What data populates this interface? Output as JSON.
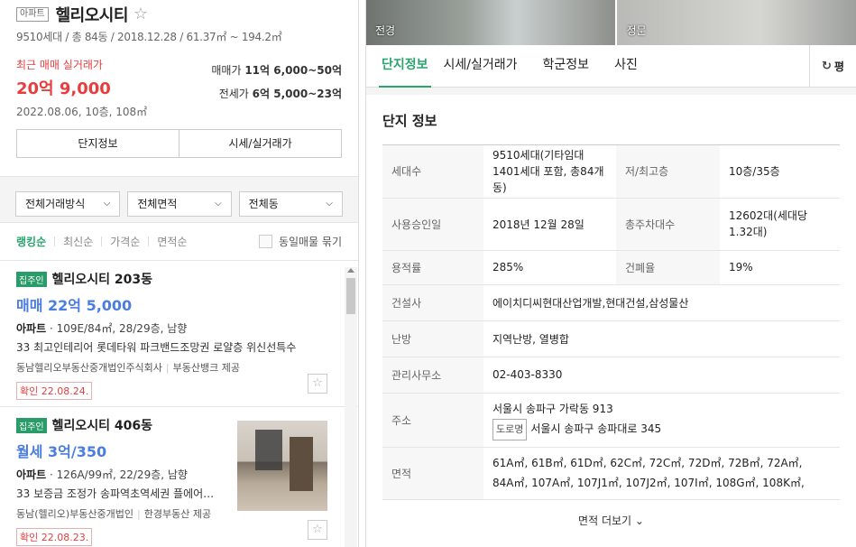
{
  "left": {
    "type_badge": "아파트",
    "name": "헬리오시티",
    "star_icon": "☆",
    "summary": "9510세대 / 총 84동 / 2018.12.28 / 61.37㎡ ~ 194.2㎡",
    "recent_label": "최근 매매 실거래가",
    "recent_price": "20억 9,000",
    "recent_date": "2022.08.06, 10층, 108㎡",
    "sale_label": "매매가",
    "sale_range": "11억 6,000~50억",
    "jeonse_label": "전세가",
    "jeonse_range": "6억 5,000~23억",
    "btn_info": "단지정보",
    "btn_price": "시세/실거래가",
    "filters": [
      "전체거래방식",
      "전체면적",
      "전체동"
    ],
    "sorts": [
      "랭킹순",
      "최신순",
      "가격순",
      "면적순"
    ],
    "dup_label": "동일매물 묶기",
    "listings": [
      {
        "badge": "집주인",
        "name": "헬리오시티 203동",
        "price": "매매 22억 5,000",
        "spec_type": "아파트",
        "spec": " · 109E/84㎡, 28/29층, 남향",
        "desc": "33 최고인테리어 롯데타워 파크밴드조망권 로얄층 위신선특수",
        "agent": "동남헬리오부동산중개법인주식회사",
        "provider": "부동산뱅크 제공",
        "confirm": "확인 22.08.24."
      },
      {
        "badge": "집주인",
        "name": "헬리오시티 406동",
        "price": "월세 3억/350",
        "spec_type": "아파트",
        "spec": " · 126A/99㎡, 22/29층, 남향",
        "desc": "33 보증금 조정가 송파역초역세권 플에어…",
        "agent": "동남(헬리오)부동산중개법인",
        "provider": "한경부동산 제공",
        "confirm": "확인 22.08.23."
      }
    ]
  },
  "right": {
    "photo1": "전경",
    "photo2": "정문",
    "tabs": [
      "단지정보",
      "시세/실거래가",
      "학군정보",
      "사진"
    ],
    "refresh_label": "평",
    "info_title": "단지 정보",
    "rows": {
      "households_k": "세대수",
      "households_v": "9510세대(기타임대 1401세대 포함, 총84개동)",
      "floors_k": "저/최고층",
      "floors_v": "10층/35층",
      "approval_k": "사용승인일",
      "approval_v": "2018년 12월 28일",
      "parking_k": "총주차대수",
      "parking_v": "12602대(세대당 1.32대)",
      "far_k": "용적률",
      "far_v": "285%",
      "bcr_k": "건폐율",
      "bcr_v": "19%",
      "builder_k": "건설사",
      "builder_v": "에이치디씨현대산업개발,현대건설,삼성물산",
      "heating_k": "난방",
      "heating_v": "지역난방, 열병합",
      "office_k": "관리사무소",
      "office_v": "02-403-8330",
      "address_k": "주소",
      "address_v": "서울시 송파구 가락동 913",
      "road_tag": "도로명",
      "road_v": "서울시 송파구 송파대로 345",
      "area_k": "면적",
      "area_v1": "61A㎡, 61B㎡, 61D㎡, 62C㎡, 72C㎡, 72D㎡, 72B㎡, 72A㎡,",
      "area_v2": "84A㎡, 107A㎡, 107J1㎡, 107J2㎡, 107I㎡, 108G㎡, 108K㎡,"
    },
    "more_label": "면적 더보기 ⌄"
  }
}
